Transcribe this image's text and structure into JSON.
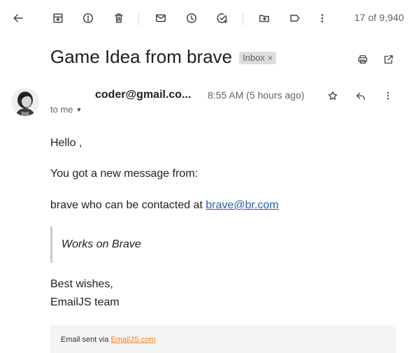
{
  "toolbar": {
    "counter": "17 of 9,940"
  },
  "email": {
    "subject": "Game Idea from brave",
    "label": "Inbox",
    "label_remove": "×",
    "sender": "coder@gmail.co...",
    "time": "8:55 AM (5 hours ago)",
    "to": "to me"
  },
  "body": {
    "greeting": "Hello ,",
    "line1": "You got a new message from:",
    "line2_prefix": "brave who can be contacted at ",
    "line2_link": "brave@br.com",
    "quote": "Works on Brave",
    "signoff1": "Best wishes,",
    "signoff2": "EmailJS team"
  },
  "footer": {
    "prefix": "Email sent via ",
    "link": "EmailJS.com"
  },
  "icons": {
    "toolbar": [
      "back-arrow-icon",
      "archive-icon",
      "report-spam-icon",
      "delete-icon",
      "mark-unread-icon",
      "snooze-icon",
      "add-to-tasks-icon",
      "move-to-icon",
      "label-icon",
      "more-vertical-icon"
    ],
    "header": [
      "print-icon",
      "open-new-window-icon",
      "star-icon",
      "reply-icon",
      "more-vertical-icon"
    ]
  },
  "colors": {
    "link": "#2a5db0",
    "footer_link": "#f58220",
    "chip_bg": "#dddddd",
    "quote_bar": "#cccccc"
  }
}
